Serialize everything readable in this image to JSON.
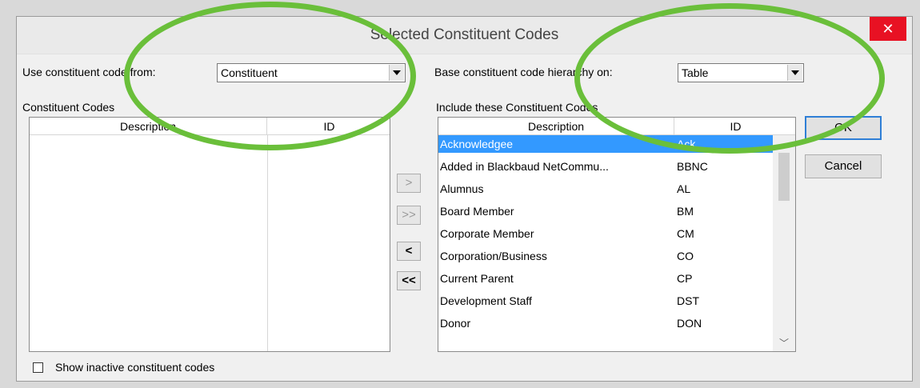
{
  "dialog": {
    "title": "Selected Constituent Codes",
    "close_glyph": "✕"
  },
  "source": {
    "label": "Use constituent code from:",
    "value": "Constituent"
  },
  "hierarchy": {
    "label": "Base constituent code hierarchy on:",
    "value": "Table"
  },
  "available": {
    "label": "Constituent Codes",
    "columns": [
      "Description",
      "ID"
    ],
    "rows": []
  },
  "included": {
    "label": "Include these Constituent Codes",
    "columns": [
      "Description",
      "ID"
    ],
    "rows": [
      {
        "description": "Acknowledgee",
        "id": "Ack",
        "selected": true
      },
      {
        "description": "Added in Blackbaud NetCommu...",
        "id": "BBNC"
      },
      {
        "description": "Alumnus",
        "id": "AL"
      },
      {
        "description": "Board Member",
        "id": "BM"
      },
      {
        "description": "Corporate Member",
        "id": "CM"
      },
      {
        "description": "Corporation/Business",
        "id": "CO"
      },
      {
        "description": "Current Parent",
        "id": "CP"
      },
      {
        "description": "Development Staff",
        "id": "DST"
      },
      {
        "description": "Donor",
        "id": "DON"
      }
    ]
  },
  "move_buttons": {
    "add": ">",
    "add_all": ">>",
    "remove": "<",
    "remove_all": "<<"
  },
  "buttons": {
    "ok": "OK",
    "cancel": "Cancel"
  },
  "show_inactive": {
    "label": "Show inactive constituent codes",
    "checked": false
  },
  "colors": {
    "selection": "#3399ff",
    "close_button": "#e81123",
    "annotation_ellipse": "#6abf3a"
  }
}
